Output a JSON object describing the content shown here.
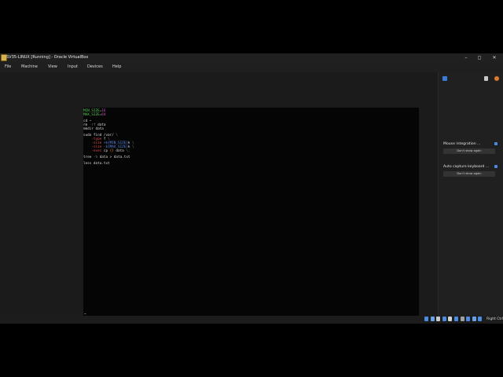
{
  "window": {
    "title": "SV35-LINUX [Running] - Oracle VirtualBox",
    "minimize_glyph": "–",
    "maximize_glyph": "◻",
    "close_glyph": "✕"
  },
  "menu": {
    "items": [
      "File",
      "Machine",
      "View",
      "Input",
      "Devices",
      "Help"
    ]
  },
  "terminal": {
    "lines": [
      {
        "segments": [
          {
            "t": "MIN_SIZE=",
            "c": "green"
          },
          {
            "t": "16",
            "c": "magenta"
          }
        ]
      },
      {
        "segments": [
          {
            "t": "MAX_SIZE=",
            "c": "green"
          },
          {
            "t": "64",
            "c": "magenta"
          }
        ]
      },
      {
        "gap": true
      },
      {
        "segments": [
          {
            "t": "cd ~",
            "c": "white"
          }
        ]
      },
      {
        "segments": [
          {
            "t": "rm ",
            "c": "white"
          },
          {
            "t": "-rf ",
            "c": "gray"
          },
          {
            "t": "data",
            "c": "white"
          }
        ]
      },
      {
        "segments": [
          {
            "t": "mkdir data",
            "c": "white"
          }
        ]
      },
      {
        "gap": true
      },
      {
        "segments": [
          {
            "t": "sudo find /var/ ",
            "c": "white"
          },
          {
            "t": "\\",
            "c": "gray"
          }
        ]
      },
      {
        "segments": [
          {
            "t": "    -type ",
            "c": "red"
          },
          {
            "t": "f ",
            "c": "white"
          },
          {
            "t": "\\",
            "c": "gray"
          }
        ]
      },
      {
        "segments": [
          {
            "t": "    -size ",
            "c": "red"
          },
          {
            "t": "+${MIN_SIZE}",
            "c": "blue"
          },
          {
            "t": "k ",
            "c": "white"
          },
          {
            "t": "\\",
            "c": "gray"
          }
        ]
      },
      {
        "segments": [
          {
            "t": "    -size ",
            "c": "red"
          },
          {
            "t": "-${MAX_SIZE}",
            "c": "blue"
          },
          {
            "t": "k ",
            "c": "white"
          },
          {
            "t": "\\",
            "c": "gray"
          }
        ]
      },
      {
        "segments": [
          {
            "t": "    -exec ",
            "c": "red"
          },
          {
            "t": "cp ",
            "c": "white"
          },
          {
            "t": "{} ",
            "c": "orange"
          },
          {
            "t": "data ",
            "c": "white"
          },
          {
            "t": "\\;",
            "c": "gray"
          }
        ]
      },
      {
        "gap": true
      },
      {
        "segments": [
          {
            "t": "tree ",
            "c": "white"
          },
          {
            "t": "-h ",
            "c": "gray"
          },
          {
            "t": "data > data.txt",
            "c": "white"
          }
        ]
      },
      {
        "gap": true
      },
      {
        "segments": [
          {
            "t": "less data.txt",
            "c": "white"
          }
        ]
      }
    ],
    "prompt": "~"
  },
  "notifications": {
    "items": [
      {
        "title": "Mouse integration ...",
        "button": "Don't show again"
      },
      {
        "title": "Auto capture keyboard ...",
        "button": "Don't show again"
      }
    ]
  },
  "statusbar": {
    "host_key_label": "Right Ctrl",
    "icon_colors": [
      "#4a8be0",
      "#6aa0e8",
      "#c8c8c8",
      "#4a8be0",
      "#d0d0d0",
      "#4a8be0",
      "#a0a0a0",
      "#4a8be0",
      "#6aa0e8",
      "#4a8be0"
    ]
  },
  "colors": {
    "green": "#5fd35f",
    "magenta": "#d24fcf",
    "red": "#e04848",
    "blue": "#5a8cf0",
    "orange": "#d7912f"
  }
}
